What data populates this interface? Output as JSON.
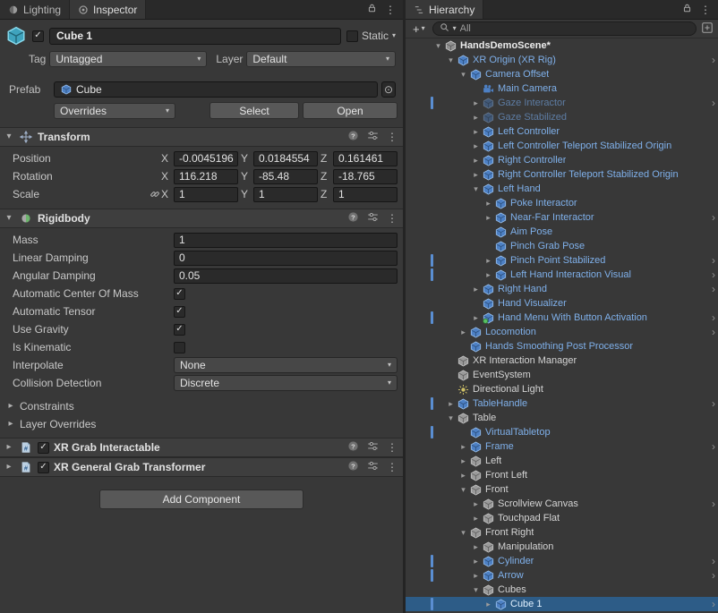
{
  "icons": {
    "fold_open": "▾",
    "fold_closed": "▸",
    "kebab": "⋮",
    "chevron_right": "›",
    "checkmark": "✓",
    "dropdown_caret": "▾",
    "object_picker": "⊙",
    "plus": "+"
  },
  "colors": {
    "selection_blue": "#2d5c87",
    "prefab_blue": "#7fb0ea",
    "override_bar_blue": "#5a8ed2"
  },
  "inspector": {
    "tabs": [
      {
        "label": "Lighting"
      },
      {
        "label": "Inspector"
      }
    ],
    "gameobject": {
      "name": "Cube 1",
      "active": true,
      "static_label": "Static",
      "tag_label": "Tag",
      "tag_value": "Untagged",
      "layer_label": "Layer",
      "layer_value": "Default",
      "prefab_label": "Prefab",
      "prefab_value": "Cube",
      "overrides_label": "Overrides",
      "select_label": "Select",
      "open_label": "Open"
    },
    "transform": {
      "title": "Transform",
      "axis_labels": [
        "X",
        "Y",
        "Z"
      ],
      "rows": [
        {
          "label": "Position",
          "values": [
            "-0.0045196",
            "0.0184554",
            "0.161461"
          ],
          "linked": false
        },
        {
          "label": "Rotation",
          "values": [
            "116.218",
            "-85.48",
            "-18.765"
          ],
          "linked": false
        },
        {
          "label": "Scale",
          "values": [
            "1",
            "1",
            "1"
          ],
          "linked": true
        }
      ]
    },
    "rigidbody": {
      "title": "Rigidbody",
      "fields": [
        {
          "label": "Mass",
          "type": "text",
          "value": "1"
        },
        {
          "label": "Linear Damping",
          "type": "text",
          "value": "0"
        },
        {
          "label": "Angular Damping",
          "type": "text",
          "value": "0.05"
        },
        {
          "label": "Automatic Center Of Mass",
          "type": "checkbox",
          "checked": true
        },
        {
          "label": "Automatic Tensor",
          "type": "checkbox",
          "checked": true
        },
        {
          "label": "Use Gravity",
          "type": "checkbox",
          "checked": true
        },
        {
          "label": "Is Kinematic",
          "type": "checkbox",
          "checked": false
        },
        {
          "label": "Interpolate",
          "type": "dropdown",
          "value": "None"
        },
        {
          "label": "Collision Detection",
          "type": "dropdown",
          "value": "Discrete"
        }
      ],
      "foldouts": [
        "Constraints",
        "Layer Overrides"
      ]
    },
    "extra_components": [
      {
        "title": "XR Grab Interactable",
        "enabled": true
      },
      {
        "title": "XR General Grab Transformer",
        "enabled": true
      }
    ],
    "add_component_label": "Add Component"
  },
  "hierarchy": {
    "tab_label": "Hierarchy",
    "search_value": "All",
    "rows": [
      {
        "label": "HandsDemoScene*",
        "level": 0,
        "icon": "scene",
        "style": "scene",
        "fold": "open"
      },
      {
        "label": "XR Origin (XR Rig)",
        "level": 1,
        "icon": "prefab",
        "style": "prefab",
        "fold": "open",
        "chevron": true
      },
      {
        "label": "Camera Offset",
        "level": 2,
        "icon": "prefab",
        "style": "prefab",
        "fold": "open"
      },
      {
        "label": "Main Camera",
        "level": 3,
        "icon": "camera",
        "style": "prefab",
        "fold": "none"
      },
      {
        "label": "Gaze Interactor",
        "level": 3,
        "icon": "prefab",
        "style": "disabled",
        "fold": "closed",
        "chevron": true,
        "bar": true
      },
      {
        "label": "Gaze Stabilized",
        "level": 3,
        "icon": "prefab",
        "style": "disabled",
        "fold": "closed"
      },
      {
        "label": "Left Controller",
        "level": 3,
        "icon": "prefab",
        "style": "prefab",
        "fold": "closed"
      },
      {
        "label": "Left Controller Teleport Stabilized Origin",
        "level": 3,
        "icon": "prefab",
        "style": "prefab",
        "fold": "closed"
      },
      {
        "label": "Right Controller",
        "level": 3,
        "icon": "prefab",
        "style": "prefab",
        "fold": "closed"
      },
      {
        "label": "Right Controller Teleport Stabilized Origin",
        "level": 3,
        "icon": "prefab",
        "style": "prefab",
        "fold": "closed"
      },
      {
        "label": "Left Hand",
        "level": 3,
        "icon": "prefab",
        "style": "prefab",
        "fold": "open"
      },
      {
        "label": "Poke Interactor",
        "level": 4,
        "icon": "prefab",
        "style": "prefab",
        "fold": "closed"
      },
      {
        "label": "Near-Far Interactor",
        "level": 4,
        "icon": "prefab",
        "style": "prefab",
        "fold": "closed",
        "chevron": true
      },
      {
        "label": "Aim Pose",
        "level": 4,
        "icon": "prefab",
        "style": "prefab",
        "fold": "none"
      },
      {
        "label": "Pinch Grab Pose",
        "level": 4,
        "icon": "prefab",
        "style": "prefab",
        "fold": "none"
      },
      {
        "label": "Pinch Point Stabilized",
        "level": 4,
        "icon": "prefab",
        "style": "prefab",
        "fold": "closed",
        "chevron": true,
        "bar": true
      },
      {
        "label": "Left Hand Interaction Visual",
        "level": 4,
        "icon": "prefab",
        "style": "prefab",
        "fold": "closed",
        "chevron": true,
        "bar": true
      },
      {
        "label": "Right Hand",
        "level": 3,
        "icon": "prefab",
        "style": "prefab",
        "fold": "closed",
        "chevron": true
      },
      {
        "label": "Hand Visualizer",
        "level": 3,
        "icon": "prefab",
        "style": "prefab",
        "fold": "none"
      },
      {
        "label": "Hand Menu With Button Activation",
        "level": 3,
        "icon": "prefabg",
        "style": "prefab",
        "fold": "closed",
        "chevron": true,
        "bar": true
      },
      {
        "label": "Locomotion",
        "level": 2,
        "icon": "prefab",
        "style": "prefab",
        "fold": "closed",
        "chevron": true
      },
      {
        "label": "Hands Smoothing Post Processor",
        "level": 2,
        "icon": "prefab",
        "style": "prefab",
        "fold": "none"
      },
      {
        "label": "XR Interaction Manager",
        "level": 1,
        "icon": "cube",
        "style": "plain",
        "fold": "none"
      },
      {
        "label": "EventSystem",
        "level": 1,
        "icon": "cube",
        "style": "plain",
        "fold": "none"
      },
      {
        "label": "Directional Light",
        "level": 1,
        "icon": "light",
        "style": "plain",
        "fold": "none"
      },
      {
        "label": "TableHandle",
        "level": 1,
        "icon": "prefab",
        "style": "prefab",
        "fold": "closed",
        "chevron": true,
        "bar": true
      },
      {
        "label": "Table",
        "level": 1,
        "icon": "cube",
        "style": "plain",
        "fold": "open"
      },
      {
        "label": "VirtualTabletop",
        "level": 2,
        "icon": "prefab",
        "style": "prefab",
        "fold": "none",
        "bar": true
      },
      {
        "label": "Frame",
        "level": 2,
        "icon": "prefab",
        "style": "prefab",
        "fold": "closed",
        "chevron": true
      },
      {
        "label": "Left",
        "level": 2,
        "icon": "cube",
        "style": "plain",
        "fold": "closed"
      },
      {
        "label": "Front Left",
        "level": 2,
        "icon": "cube",
        "style": "plain",
        "fold": "closed"
      },
      {
        "label": "Front",
        "level": 2,
        "icon": "cube",
        "style": "plain",
        "fold": "open"
      },
      {
        "label": "Scrollview Canvas",
        "level": 3,
        "icon": "cube",
        "style": "plain",
        "fold": "closed",
        "chevron": true
      },
      {
        "label": "Touchpad Flat",
        "level": 3,
        "icon": "cube",
        "style": "plain",
        "fold": "closed"
      },
      {
        "label": "Front Right",
        "level": 2,
        "icon": "cube",
        "style": "plain",
        "fold": "open"
      },
      {
        "label": "Manipulation",
        "level": 3,
        "icon": "cube",
        "style": "plain",
        "fold": "closed"
      },
      {
        "label": "Cylinder",
        "level": 3,
        "icon": "prefab",
        "style": "prefab",
        "fold": "closed",
        "chevron": true,
        "bar": true
      },
      {
        "label": "Arrow",
        "level": 3,
        "icon": "prefab",
        "style": "prefab",
        "fold": "closed",
        "chevron": true,
        "bar": true
      },
      {
        "label": "Cubes",
        "level": 3,
        "icon": "cube",
        "style": "plain",
        "fold": "open"
      },
      {
        "label": "Cube 1",
        "level": 4,
        "icon": "prefab",
        "style": "prefab",
        "fold": "closed",
        "chevron": true,
        "bar": true,
        "selected": true
      }
    ]
  }
}
